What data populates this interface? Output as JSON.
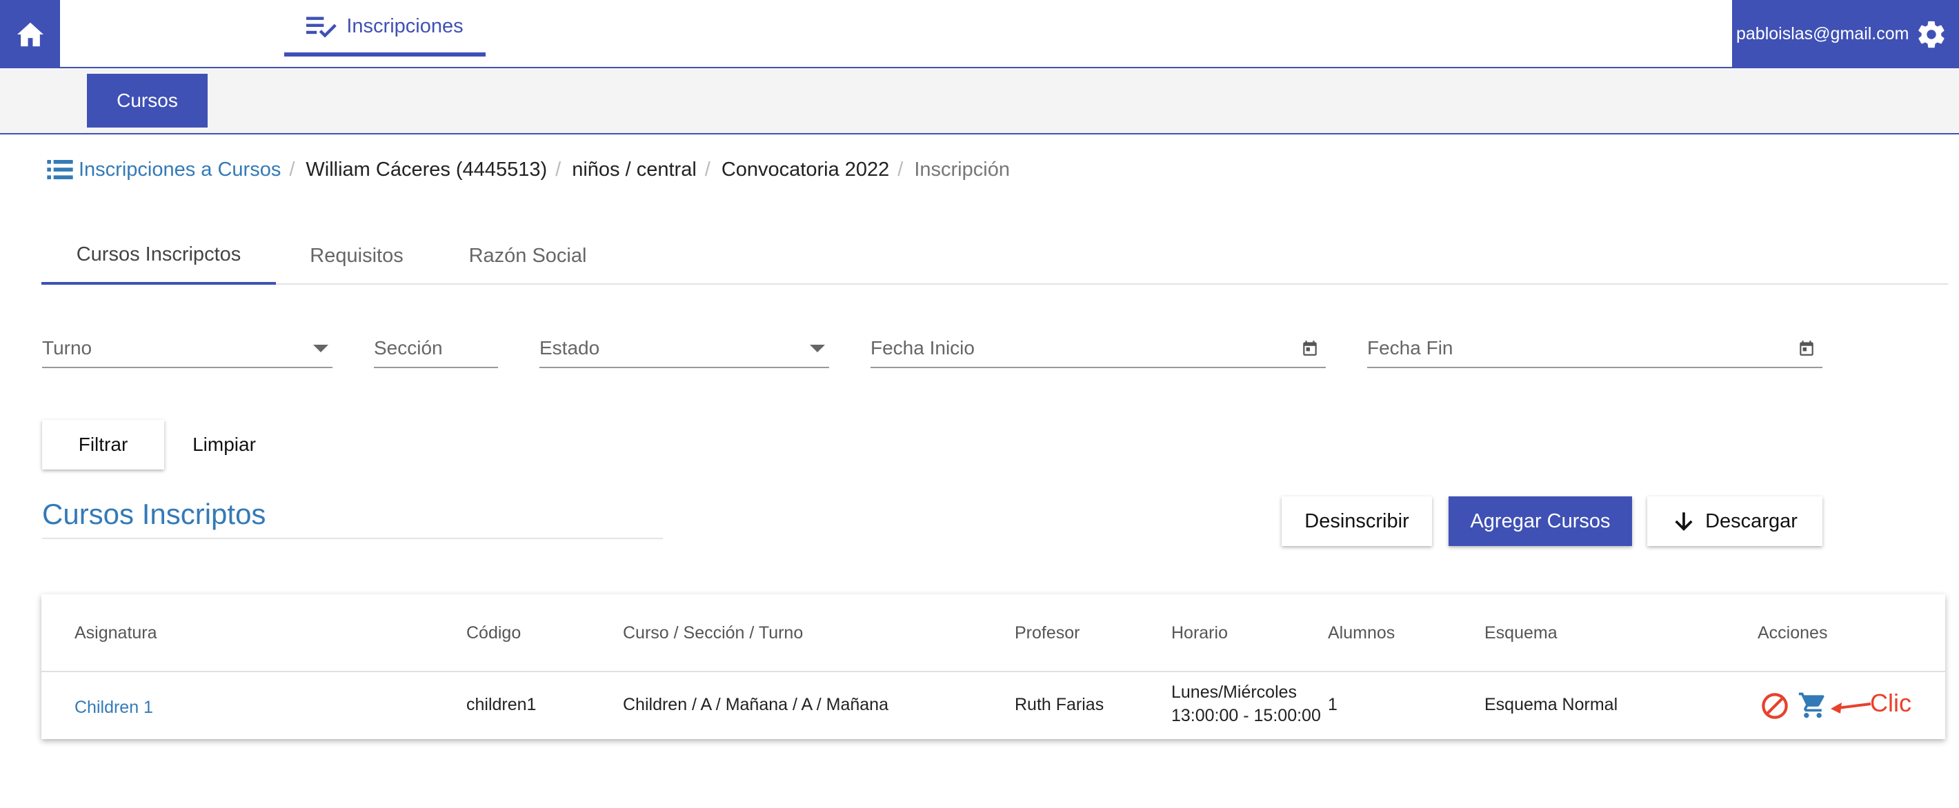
{
  "topbar": {
    "home_icon": "home-icon",
    "nav_tab_label": "Inscripciones",
    "nav_tab_icon": "playlist-check-icon",
    "user_email": "pabloislas@gmail.com",
    "settings_icon": "gear-icon",
    "accent_color": "#3f51b5"
  },
  "subbar": {
    "cursos_label": "Cursos"
  },
  "breadcrumb": {
    "items": [
      {
        "label": "Inscripciones a Cursos",
        "icon": "list-icon"
      },
      {
        "label": "William Cáceres (4445513)"
      },
      {
        "label": "niños / central"
      },
      {
        "label": "Convocatoria 2022"
      },
      {
        "label": "Inscripción"
      }
    ],
    "separator": "/"
  },
  "tabs": [
    {
      "label": "Cursos Inscripctos",
      "active": true
    },
    {
      "label": "Requisitos",
      "active": false
    },
    {
      "label": "Razón Social",
      "active": false
    }
  ],
  "filters": {
    "turno": "Turno",
    "seccion": "Sección",
    "estado": "Estado",
    "fecha_inicio": "Fecha Inicio",
    "fecha_fin": "Fecha Fin",
    "filtrar_label": "Filtrar",
    "limpiar_label": "Limpiar"
  },
  "section": {
    "title": "Cursos Inscriptos",
    "desinscribir_label": "Desinscribir",
    "agregar_label": "Agregar Cursos",
    "descargar_label": "Descargar",
    "descargar_icon": "arrow-down-icon"
  },
  "table": {
    "headers": [
      "Asignatura",
      "Código",
      "Curso / Sección / Turno",
      "Profesor",
      "Horario",
      "Alumnos",
      "Esquema",
      "Acciones"
    ],
    "rows": [
      {
        "asignatura": "Children 1",
        "codigo": "children1",
        "curso": "Children / A / Mañana / A / Mañana",
        "profesor": "Ruth Farias",
        "horario_dias": "Lunes/Miércoles",
        "horario_horas": "13:00:00 - 15:00:00",
        "alumnos": "1",
        "esquema": "Esquema Normal",
        "actions": [
          "block-icon",
          "cart-icon"
        ]
      }
    ]
  },
  "annotation": {
    "label": "Clic",
    "color": "#e8412c"
  }
}
